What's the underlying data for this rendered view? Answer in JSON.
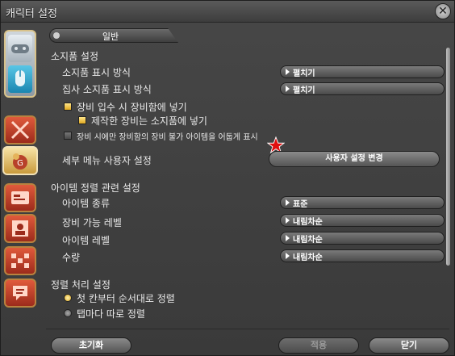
{
  "window": {
    "title": "캐릭터 설정"
  },
  "tab": {
    "label": "일반"
  },
  "sections": {
    "item_box": {
      "title": "소지품 설정"
    },
    "sorting": {
      "title": "아이템 정렬 관련 설정"
    },
    "process": {
      "title": "정렬 처리 설정"
    }
  },
  "item_box": {
    "display_mode": {
      "label": "소지품 표시 방식",
      "value": "펼치기"
    },
    "retainer_display_mode": {
      "label": "집사 소지품 표시 방식",
      "value": "펼치기"
    },
    "gear_to_armoury": {
      "label": "장비 입수 시 장비함에 넣기",
      "checked": true
    },
    "crafted_to_inventory": {
      "label": "제작한 장비는 소지품에 넣기",
      "checked": true
    },
    "dim_unequippable": {
      "label": "장비 시에만 장비함의 장비 불가 아이템을 어둡게 표시",
      "checked": false
    },
    "submenu_custom": {
      "label": "세부 메뉴 사용자 설정",
      "button": "사용자 설정 변경"
    }
  },
  "sorting": [
    {
      "label": "아이템 종류",
      "value": "표준"
    },
    {
      "label": "장비 가능 레벨",
      "value": "내림차순"
    },
    {
      "label": "아이템 레벨",
      "value": "내림차순"
    },
    {
      "label": "수량",
      "value": "내림차순"
    }
  ],
  "process": {
    "options": [
      {
        "label": "첫 칸부터 순서대로 정렬",
        "selected": true
      },
      {
        "label": "탭마다 따로 정렬",
        "selected": false
      }
    ]
  },
  "footer": {
    "reset": "초기화",
    "apply": "적용",
    "close": "닫기"
  },
  "colors": {
    "accent_star": "#e01010",
    "checkbox_on": "#f0c040"
  }
}
